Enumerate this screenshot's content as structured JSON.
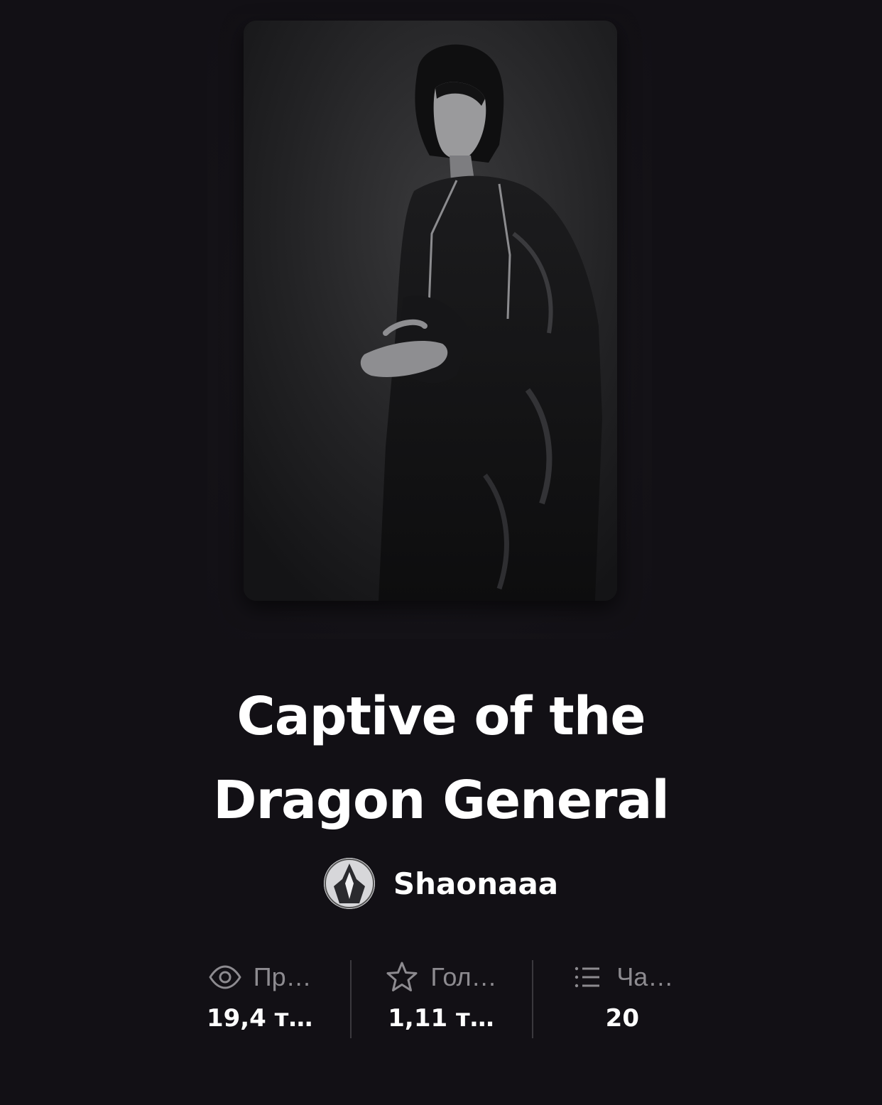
{
  "story": {
    "title_line1": "Captive of the",
    "title_line2": "Dragon General",
    "author": "Shaonaaa"
  },
  "stats": [
    {
      "icon": "eye-icon",
      "label": "Пр…",
      "value": "19,4 т…"
    },
    {
      "icon": "star-icon",
      "label": "Гол…",
      "value": "1,11 т…"
    },
    {
      "icon": "list-icon",
      "label": "Ча…",
      "value": "20"
    }
  ],
  "colors": {
    "background": "#121015",
    "text": "#ffffff",
    "muted": "#8d8b90"
  }
}
